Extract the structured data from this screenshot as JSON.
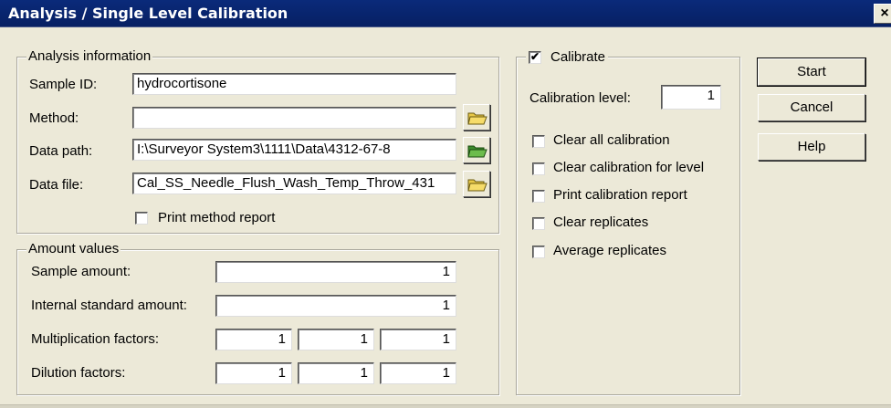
{
  "window": {
    "title": "Analysis / Single Level Calibration",
    "close_glyph": "×"
  },
  "analysis_info": {
    "group_label": "Analysis information",
    "sample_id_label": "Sample ID:",
    "sample_id_value": "hydrocortisone",
    "method_label": "Method:",
    "method_value": "",
    "data_path_label": "Data path:",
    "data_path_value": "I:\\Surveyor System3\\1111\\Data\\4312-67-8",
    "data_file_label": "Data file:",
    "data_file_value": "Cal_SS_Needle_Flush_Wash_Temp_Throw_431",
    "print_method_report_label": "Print method report",
    "print_method_report_checked": false,
    "folder_icon": "folder-open-icon"
  },
  "amount_values": {
    "group_label": "Amount values",
    "sample_amount_label": "Sample amount:",
    "sample_amount_value": "1",
    "internal_standard_label": "Internal standard amount:",
    "internal_standard_value": "1",
    "multiplication_label": "Multiplication factors:",
    "multiplication_values": [
      "1",
      "1",
      "1"
    ],
    "dilution_label": "Dilution factors:",
    "dilution_values": [
      "1",
      "1",
      "1"
    ]
  },
  "calibrate": {
    "group_label": "Calibrate",
    "calibrate_checked": true,
    "check_glyph": "✔",
    "level_label": "Calibration level:",
    "level_value": "1",
    "options": [
      {
        "label": "Clear all calibration",
        "checked": false
      },
      {
        "label": "Clear calibration for level",
        "checked": false
      },
      {
        "label": "Print calibration report",
        "checked": false
      },
      {
        "label": "Clear replicates",
        "checked": false
      },
      {
        "label": "Average replicates",
        "checked": false
      }
    ]
  },
  "buttons": {
    "start": "Start",
    "cancel": "Cancel",
    "help": "Help"
  },
  "colors": {
    "title_bar": "#0a2a7a",
    "dialog_bg": "#ece9d8",
    "folder_green": "#3c8c2c",
    "folder_yellow": "#e8c848"
  }
}
